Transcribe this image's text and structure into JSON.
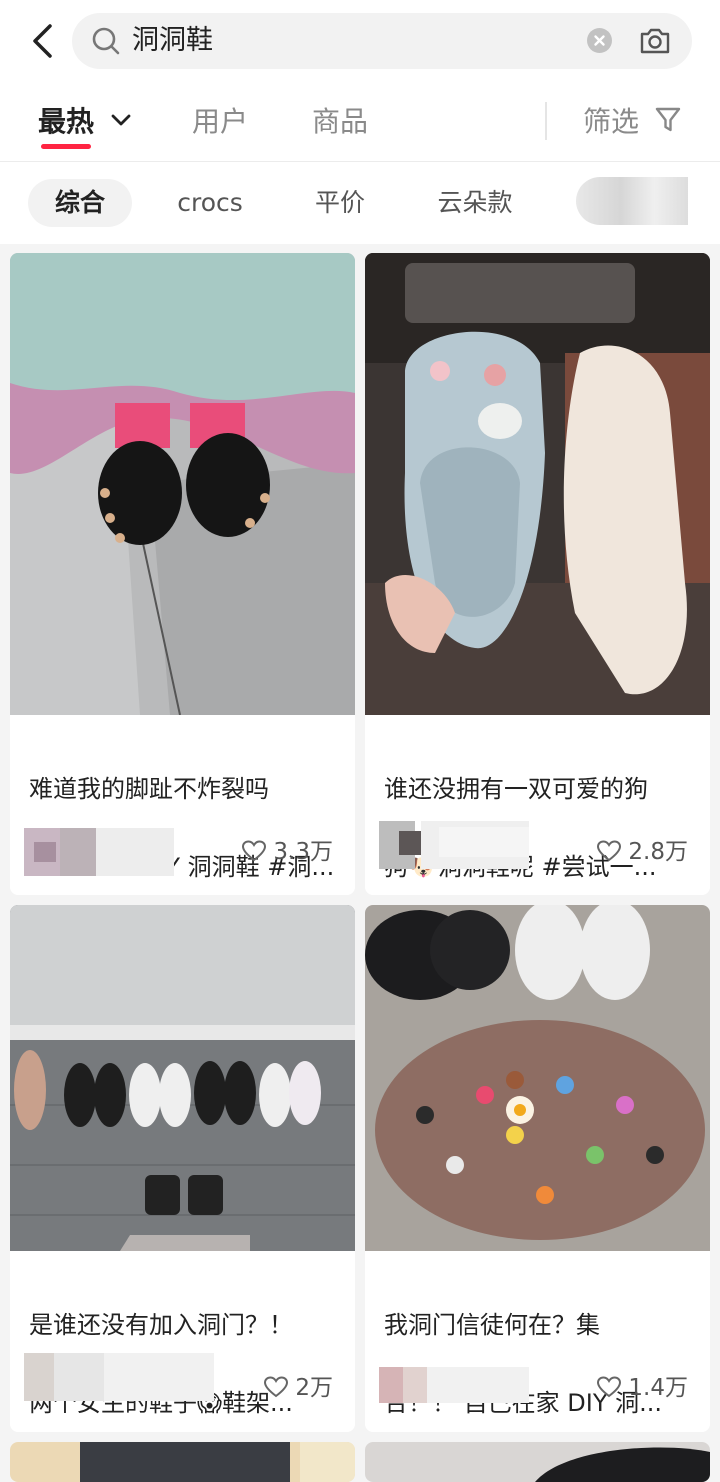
{
  "search": {
    "query": "洞洞鞋"
  },
  "tabs": {
    "hot": "最热",
    "users": "用户",
    "goods": "商品",
    "filter": "筛选"
  },
  "chips": [
    "综合",
    "crocs",
    "平价",
    "云朵款"
  ],
  "cards": [
    {
      "title_line1": "难道我的脚趾不炸裂吗",
      "title_line2": "#crocs #DIY 洞洞鞋 #洞...",
      "likes": "3.3万"
    },
    {
      "title_line1": "谁还没拥有一双可爱的狗",
      "title_line2": "狗🐶洞洞鞋呢 #尝试一...",
      "likes": "2.8万"
    },
    {
      "title_line1": "是谁还没有加入洞门？！",
      "title_line2": "两个女生的鞋子😱鞋架...",
      "likes": "2万"
    },
    {
      "title_line1": "我洞门信徒何在？集",
      "title_line2": "合！！ 自己在家 DIY 洞...",
      "likes": "1.4万"
    }
  ],
  "colors": {
    "accent": "#ff2442",
    "text": "#222222",
    "muted": "#8a8a8a"
  },
  "icons": [
    "back-arrow-icon",
    "search-icon",
    "clear-icon",
    "camera-icon",
    "chevron-down-icon",
    "filter-icon",
    "heart-icon"
  ]
}
